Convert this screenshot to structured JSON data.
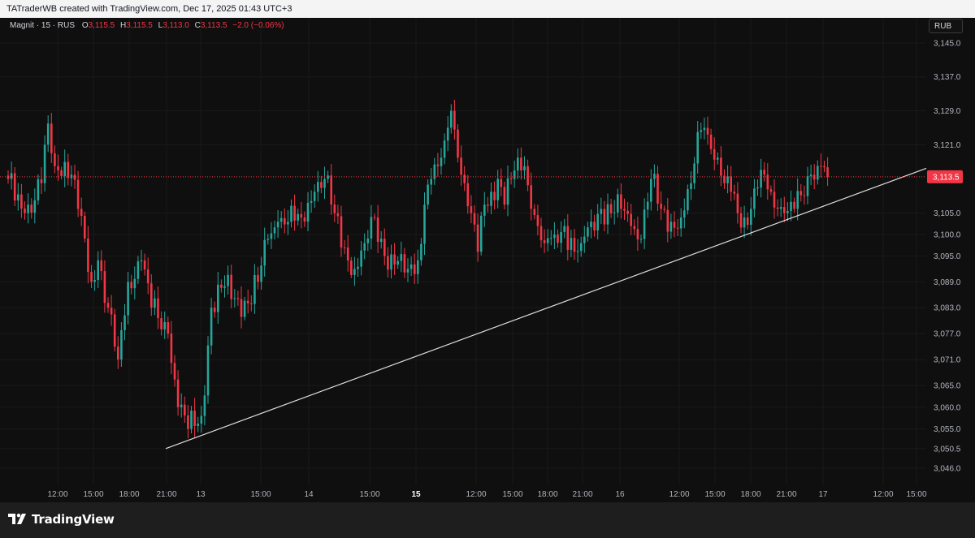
{
  "header": {
    "attribution": "TATraderWB created with TradingView.com, Dec 17, 2025 01:43 UTC+3"
  },
  "legend": {
    "symbol": "Magnit · 15 · RUS",
    "o_label": "O",
    "o_value": "3,115.5",
    "h_label": "H",
    "h_value": "3,115.5",
    "l_label": "L",
    "l_value": "3,113.0",
    "c_label": "C",
    "c_value": "3,113.5",
    "change": "−2.0 (−0.06%)"
  },
  "currency": "RUB",
  "brand": "TradingView",
  "colors": {
    "background": "#0f0f0f",
    "up": "#26a69a",
    "down": "#f23645",
    "trendline": "#e0e0e0",
    "price_label_bg": "#f23645"
  },
  "chart_data": {
    "type": "candlestick",
    "timeframe": "15",
    "current_price": 3113.5,
    "current_price_label": "3,113.5",
    "y_scale": "log",
    "y_ticks": [
      3145.0,
      3137.0,
      3129.0,
      3121.0,
      3113.5,
      3105.0,
      3100.0,
      3095.0,
      3089.0,
      3083.0,
      3077.0,
      3071.0,
      3065.0,
      3060.0,
      3055.0,
      3050.5,
      3046.0
    ],
    "y_tick_labels": [
      "3,145.0",
      "3,137.0",
      "3,129.0",
      "3,121.0",
      "3,105.0",
      "3,100.0",
      "3,095.0",
      "3,089.0",
      "3,083.0",
      "3,077.0",
      "3,071.0",
      "3,065.0",
      "3,060.0",
      "3,055.0",
      "3,050.5",
      "3,046.0"
    ],
    "x_ticks": [
      {
        "label": "12:00",
        "bold": false
      },
      {
        "label": "15:00",
        "bold": false
      },
      {
        "label": "18:00",
        "bold": false
      },
      {
        "label": "21:00",
        "bold": false
      },
      {
        "label": "13",
        "bold": false
      },
      {
        "label": "15:00",
        "bold": false
      },
      {
        "label": "14",
        "bold": false
      },
      {
        "label": "15:00",
        "bold": false
      },
      {
        "label": "15",
        "bold": true
      },
      {
        "label": "12:00",
        "bold": false
      },
      {
        "label": "15:00",
        "bold": false
      },
      {
        "label": "18:00",
        "bold": false
      },
      {
        "label": "21:00",
        "bold": false
      },
      {
        "label": "16",
        "bold": false
      },
      {
        "label": "12:00",
        "bold": false
      },
      {
        "label": "15:00",
        "bold": false
      },
      {
        "label": "18:00",
        "bold": false
      },
      {
        "label": "21:00",
        "bold": false
      },
      {
        "label": "17",
        "bold": false
      },
      {
        "label": "12:00",
        "bold": false
      },
      {
        "label": "15:00",
        "bold": false
      }
    ],
    "trendline": {
      "start_price": 3050.5,
      "end_price": 3115.5
    },
    "anchors": [
      [
        0,
        3113
      ],
      [
        5,
        3105
      ],
      [
        8,
        3108
      ],
      [
        10,
        3112
      ],
      [
        12,
        3126
      ],
      [
        14,
        3116
      ],
      [
        17,
        3117
      ],
      [
        19,
        3114
      ],
      [
        21,
        3106
      ],
      [
        25,
        3089
      ],
      [
        27,
        3094
      ],
      [
        30,
        3083
      ],
      [
        33,
        3071
      ],
      [
        36,
        3089
      ],
      [
        40,
        3094
      ],
      [
        43,
        3083
      ],
      [
        48,
        3077
      ],
      [
        51,
        3060
      ],
      [
        54,
        3055
      ],
      [
        58,
        3058
      ],
      [
        61,
        3083
      ],
      [
        65,
        3088
      ],
      [
        69,
        3085
      ],
      [
        72,
        3084
      ],
      [
        75,
        3089
      ],
      [
        78,
        3099
      ],
      [
        81,
        3103
      ],
      [
        84,
        3103
      ],
      [
        88,
        3104
      ],
      [
        92,
        3110
      ],
      [
        95,
        3113
      ],
      [
        98,
        3105
      ],
      [
        101,
        3097
      ],
      [
        104,
        3092
      ],
      [
        107,
        3098
      ],
      [
        110,
        3104
      ],
      [
        113,
        3095
      ],
      [
        116,
        3093
      ],
      [
        120,
        3092
      ],
      [
        123,
        3094
      ],
      [
        125,
        3107
      ],
      [
        127,
        3113
      ],
      [
        129,
        3116
      ],
      [
        131,
        3122
      ],
      [
        133,
        3129
      ],
      [
        135,
        3118
      ],
      [
        137,
        3112
      ],
      [
        139,
        3105
      ],
      [
        141,
        3096
      ],
      [
        143,
        3107
      ],
      [
        145,
        3110
      ],
      [
        147,
        3113
      ],
      [
        149,
        3107
      ],
      [
        151,
        3113
      ],
      [
        153,
        3118
      ],
      [
        155,
        3116
      ],
      [
        157,
        3106
      ],
      [
        159,
        3102
      ],
      [
        161,
        3098
      ],
      [
        164,
        3100
      ],
      [
        167,
        3102
      ],
      [
        170,
        3096
      ],
      [
        172,
        3098
      ],
      [
        175,
        3103
      ],
      [
        178,
        3106
      ],
      [
        181,
        3105
      ],
      [
        184,
        3106
      ],
      [
        187,
        3102
      ],
      [
        190,
        3099
      ],
      [
        193,
        3113
      ],
      [
        196,
        3106
      ],
      [
        199,
        3103
      ],
      [
        202,
        3104
      ],
      [
        205,
        3112
      ],
      [
        207,
        3124
      ],
      [
        209,
        3125
      ],
      [
        211,
        3120
      ],
      [
        213,
        3118
      ],
      [
        215,
        3112
      ],
      [
        217,
        3110
      ],
      [
        219,
        3105
      ],
      [
        221,
        3104
      ],
      [
        223,
        3106
      ],
      [
        225,
        3111
      ],
      [
        227,
        3114
      ],
      [
        229,
        3110
      ],
      [
        231,
        3106
      ],
      [
        233,
        3105
      ],
      [
        236,
        3106
      ],
      [
        239,
        3109
      ],
      [
        241,
        3114
      ],
      [
        244,
        3116
      ],
      [
        246,
        3113.5
      ]
    ]
  }
}
